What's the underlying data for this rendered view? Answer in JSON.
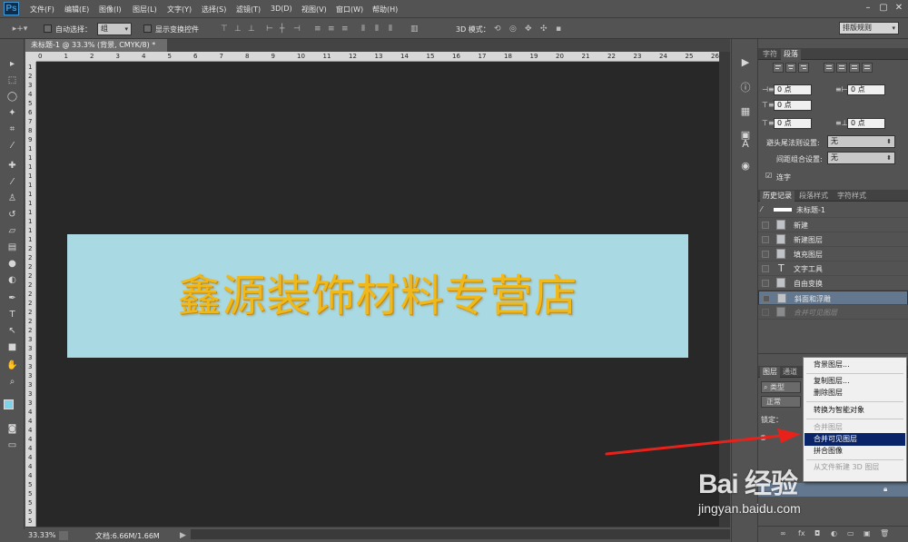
{
  "app": {
    "logo": "Ps"
  },
  "menu": [
    "文件(F)",
    "编辑(E)",
    "图像(I)",
    "图层(L)",
    "文字(Y)",
    "选择(S)",
    "滤镜(T)",
    "3D(D)",
    "视图(V)",
    "窗口(W)",
    "帮助(H)"
  ],
  "options": {
    "auto_select_label": "自动选择：",
    "auto_select_value": "组",
    "show_transform_label": "显示变换控件",
    "mode_3d_label": "3D 模式：",
    "workspace_value": "排版规则"
  },
  "document": {
    "tab_title": "未标题-1 @ 33.3% (背景, CMYK/8) *",
    "headline": "鑫源装饰材料专营店",
    "canvas_bg": "#a9d9e2",
    "headline_color": "#f0b91b"
  },
  "ruler": {
    "top": [
      "0",
      "1",
      "2",
      "3",
      "4",
      "5",
      "6",
      "7",
      "8",
      "9",
      "10",
      "11",
      "12",
      "13",
      "14",
      "15",
      "16",
      "17",
      "18",
      "19",
      "20",
      "21",
      "22",
      "23",
      "24",
      "25",
      "26"
    ],
    "left": [
      "1",
      "2",
      "3",
      "4",
      "5",
      "6",
      "7",
      "8",
      "9",
      "1",
      "1",
      "1",
      "1",
      "1",
      "1",
      "1",
      "1",
      "1",
      "1",
      "1",
      "2",
      "2",
      "2",
      "2",
      "2",
      "2",
      "2",
      "2",
      "2",
      "2",
      "3",
      "3",
      "3",
      "3",
      "3",
      "3",
      "3",
      "3",
      "4",
      "4",
      "4",
      "4",
      "4",
      "4",
      "4",
      "4",
      "5",
      "5",
      "5",
      "5",
      "5"
    ]
  },
  "status": {
    "zoom": "33.33%",
    "doc_info": "文档:6.66M/1.66M"
  },
  "character_panel": {
    "tabs": [
      "字符",
      "段落"
    ],
    "fields": [
      "0 点",
      "0 点",
      "0 点",
      "0 点",
      "0 点"
    ],
    "hyphen_label": "避头尾法则设置:",
    "hyphen_value": "无",
    "spacing_label": "间距组合设置:",
    "spacing_value": "无",
    "hyphenate_label": "连字"
  },
  "history_panel": {
    "tabs": [
      "历史记录",
      "段落样式",
      "字符样式"
    ],
    "snapshot": "未标题-1",
    "items": [
      "新建",
      "新建图层",
      "填充图层",
      "文字工具",
      "自由变换",
      "斜面和浮雕",
      "合并可见图层"
    ]
  },
  "layers_panel": {
    "tabs": [
      "图层",
      "通道"
    ],
    "kind_label": "类型",
    "blend_mode": "正常",
    "lock_label": "锁定："
  },
  "context_menu": {
    "items": [
      "背景图层...",
      "复制图层...",
      "删除图层",
      "转换为智能对象",
      "合并图层",
      "合并可见图层",
      "拼合图像",
      "从文件新建 3D 图层"
    ],
    "disabled": [
      "合并图层",
      "从文件新建 3D 图层"
    ],
    "highlighted": "合并可见图层"
  },
  "watermark": {
    "brand": "Bai 经验",
    "url": "jingyan.baidu.com"
  },
  "colors": {
    "accent_red": "#e8221b",
    "menu_highlight": "#0a246a",
    "history_selected": "#63778e"
  }
}
